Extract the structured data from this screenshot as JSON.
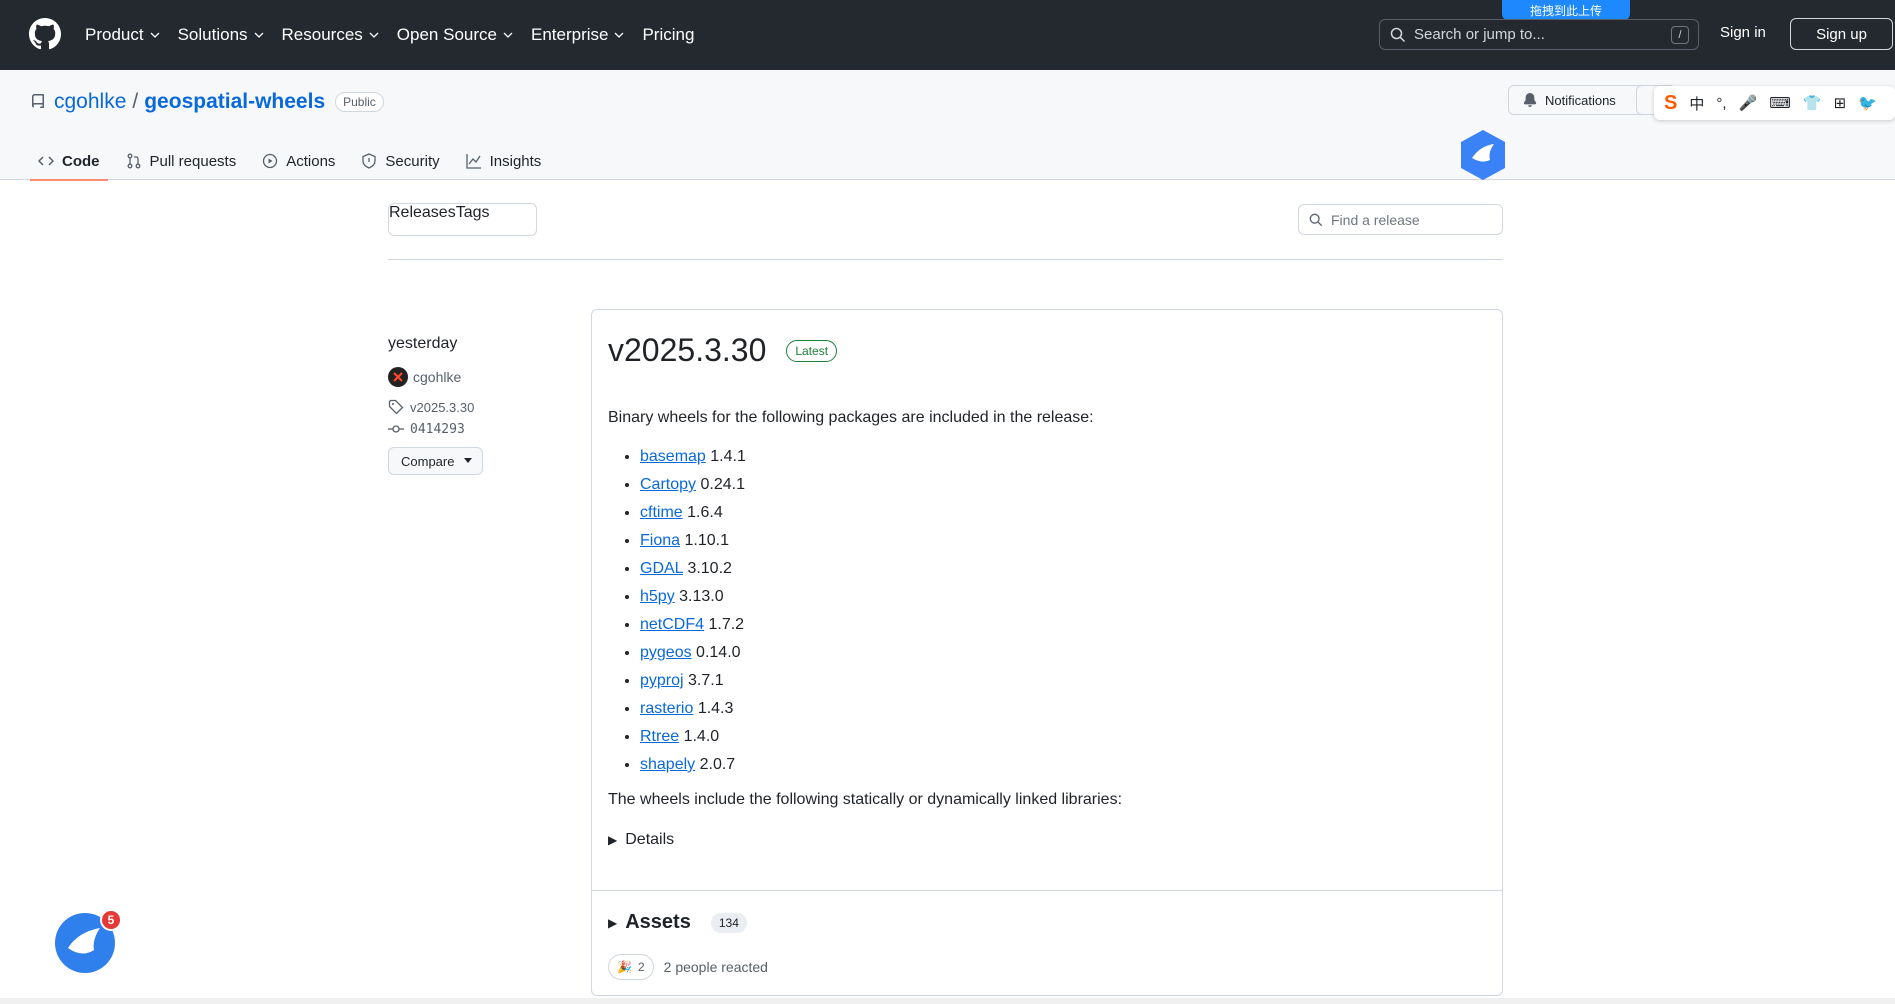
{
  "topbar": {
    "nav": [
      "Product",
      "Solutions",
      "Resources",
      "Open Source",
      "Enterprise",
      "Pricing"
    ],
    "search_placeholder": "Search or jump to...",
    "search_shortcut": "/",
    "signin": "Sign in",
    "signup": "Sign up",
    "overlay_badge": "拖拽到此上传"
  },
  "repo": {
    "owner": "cgohlke",
    "separator": "/",
    "name": "geospatial-wheels",
    "visibility": "Public",
    "notifications": "Notifications",
    "tabs": [
      "Code",
      "Pull requests",
      "Actions",
      "Security",
      "Insights"
    ]
  },
  "ime": {
    "items": [
      "S",
      "中",
      "°,",
      "🎤",
      "⌨",
      "👕",
      "⊞",
      "🐦"
    ]
  },
  "releases_nav": {
    "releases": "Releases",
    "tags": "Tags",
    "find_placeholder": "Find a release"
  },
  "meta": {
    "date": "yesterday",
    "author": "cgohlke",
    "tag": "v2025.3.30",
    "commit": "0414293",
    "compare": "Compare"
  },
  "release": {
    "title": "v2025.3.30",
    "badge": "Latest",
    "intro": "Binary wheels for the following packages are included in the release:",
    "packages": [
      {
        "name": "basemap",
        "version": "1.4.1"
      },
      {
        "name": "Cartopy",
        "version": "0.24.1"
      },
      {
        "name": "cftime",
        "version": "1.6.4"
      },
      {
        "name": "Fiona",
        "version": "1.10.1"
      },
      {
        "name": "GDAL",
        "version": "3.10.2"
      },
      {
        "name": "h5py",
        "version": "3.13.0"
      },
      {
        "name": "netCDF4",
        "version": "1.7.2"
      },
      {
        "name": "pygeos",
        "version": "0.14.0"
      },
      {
        "name": "pyproj",
        "version": "3.7.1"
      },
      {
        "name": "rasterio",
        "version": "1.4.3"
      },
      {
        "name": "Rtree",
        "version": "1.4.0"
      },
      {
        "name": "shapely",
        "version": "2.0.7"
      }
    ],
    "linked": "The wheels include the following statically or dynamically linked libraries:",
    "details": "Details",
    "assets_label": "Assets",
    "assets_count": "134",
    "reaction_count": "2",
    "reaction_text": "2 people reacted"
  },
  "floating": {
    "badge_count": "5"
  },
  "colors": {
    "header_bg": "#24292f",
    "link": "#0969da",
    "latest": "#1a7f37",
    "tab_underline": "#fd8c73"
  }
}
